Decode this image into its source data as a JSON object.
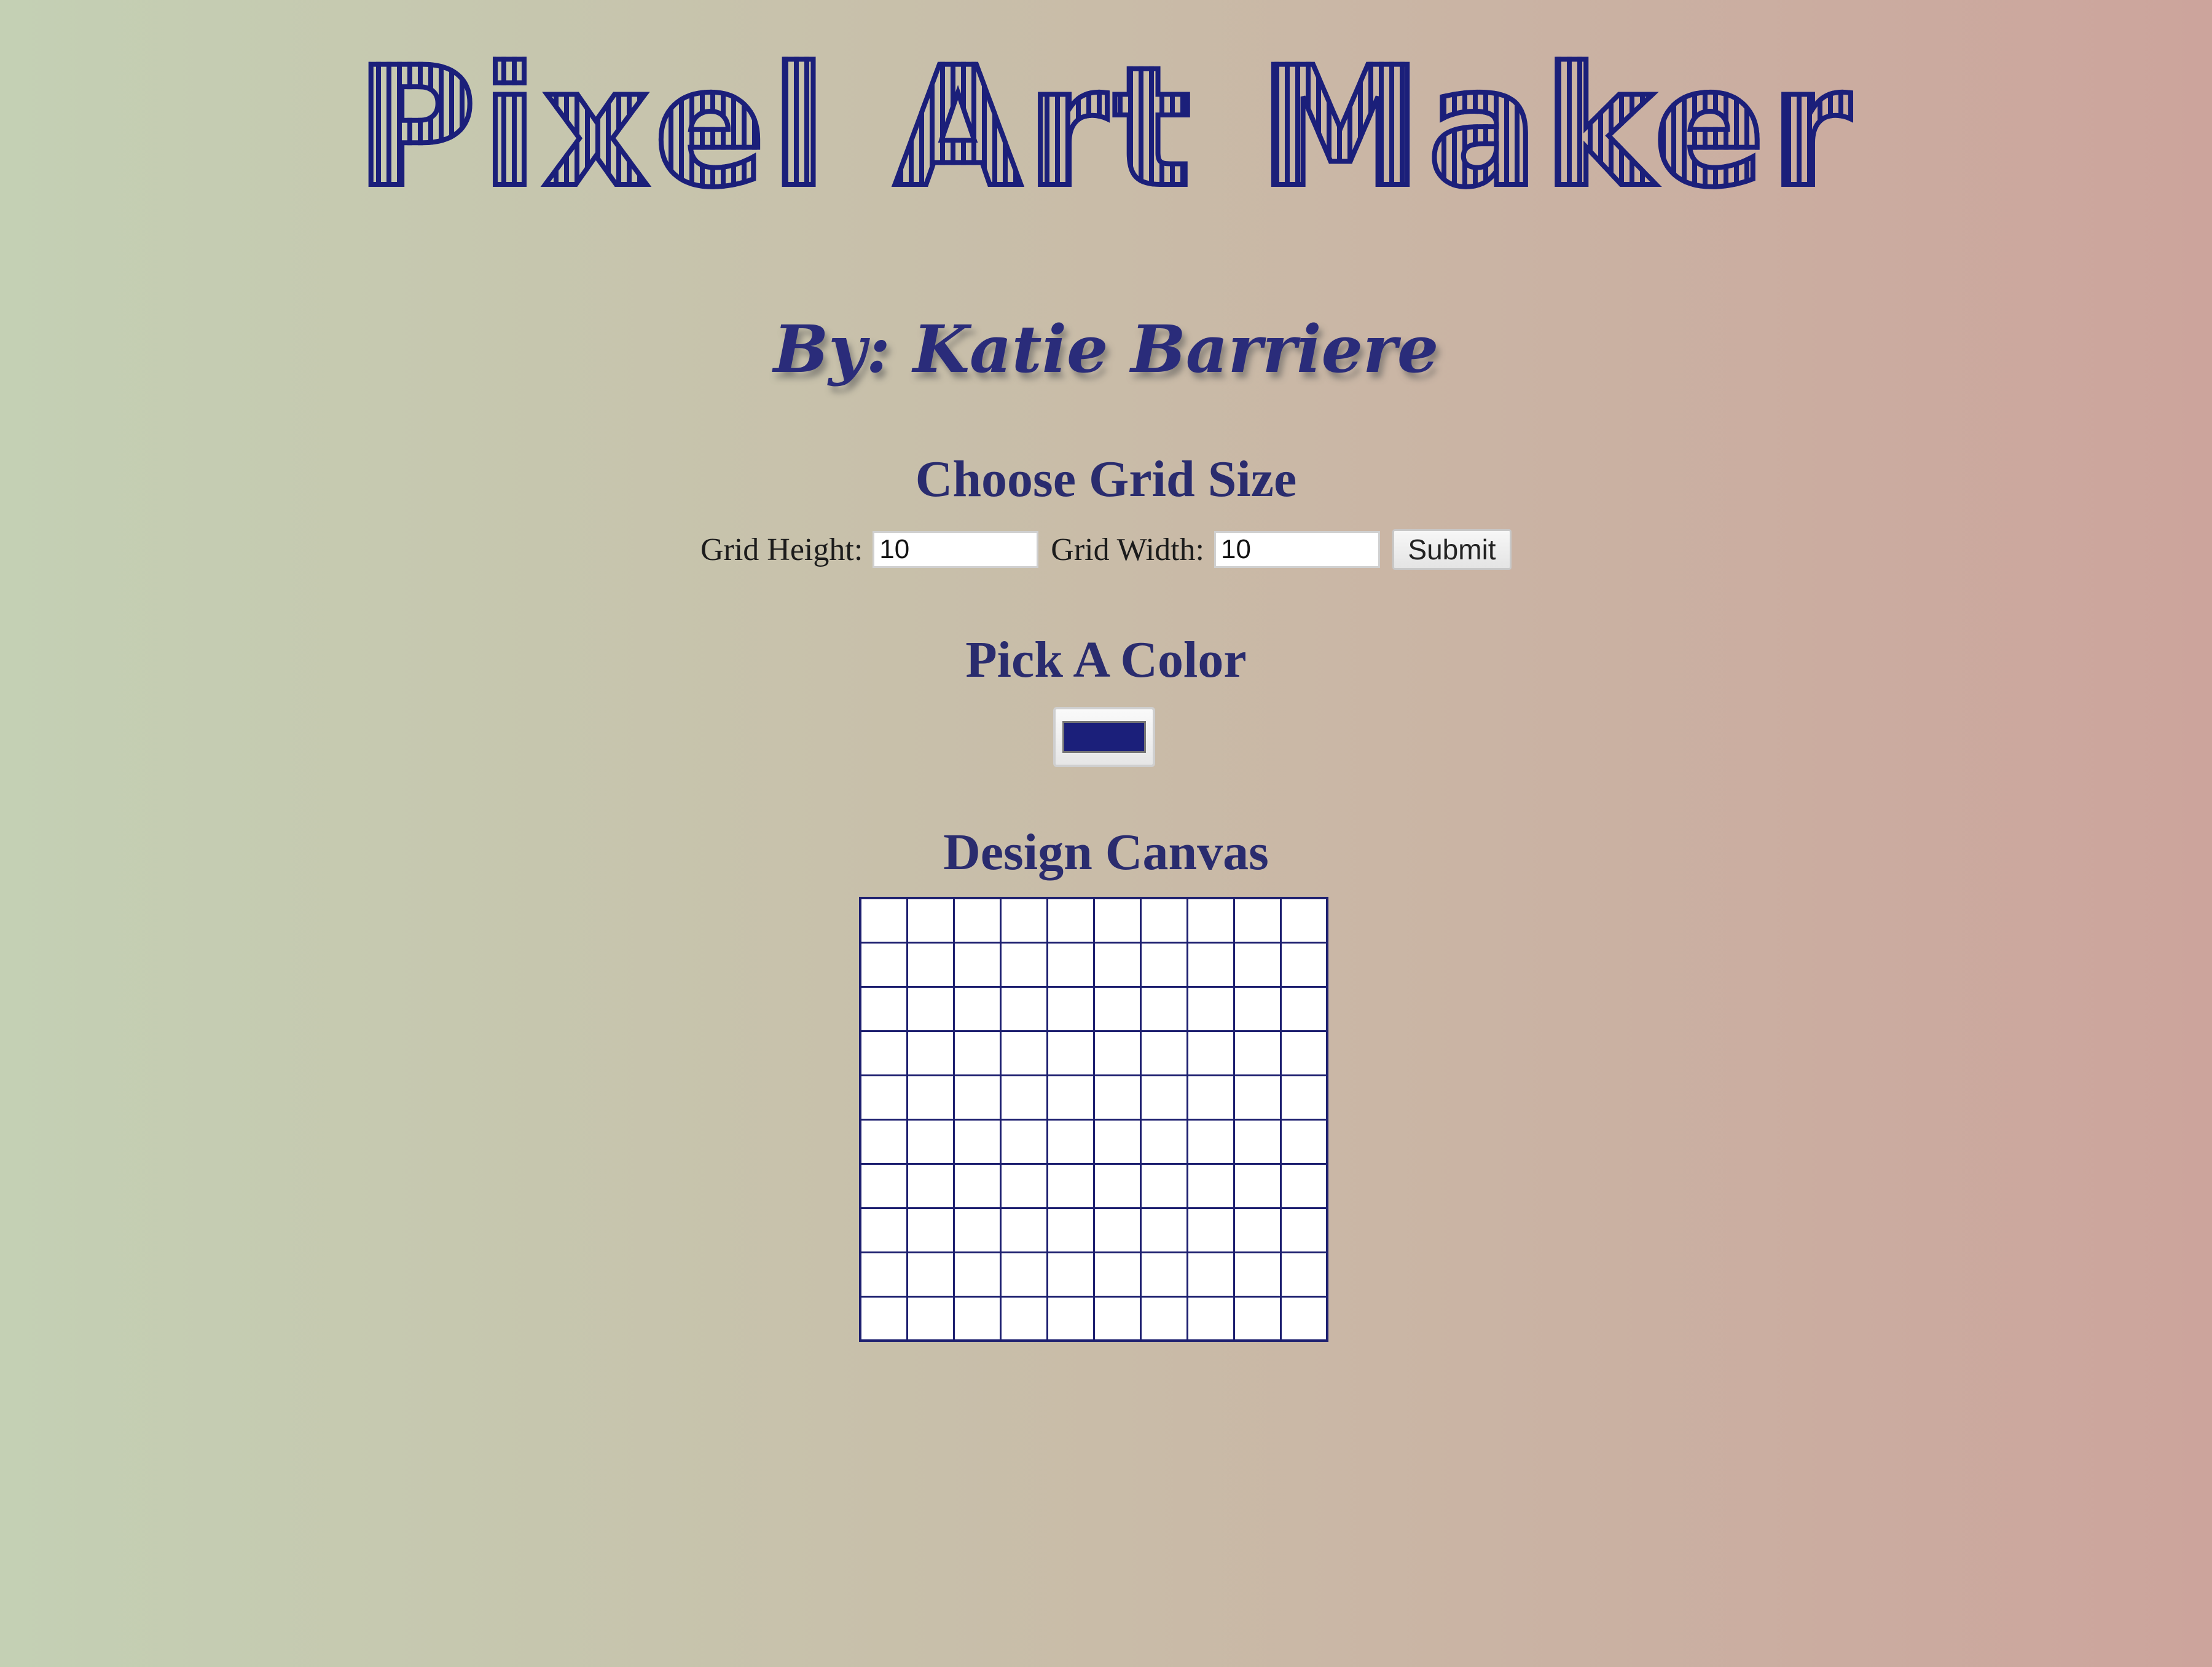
{
  "app": {
    "title": "Pixel Art Maker",
    "author": "By: Katie Barriere"
  },
  "grid_size": {
    "heading": "Choose Grid Size",
    "height_label": "Grid Height:",
    "height_value": "10",
    "width_label": "Grid Width:",
    "width_value": "10",
    "submit_label": "Submit"
  },
  "color": {
    "heading": "Pick A Color",
    "selected": "#1b1f7a"
  },
  "canvas": {
    "heading": "Design Canvas",
    "rows": 10,
    "columns": 10
  },
  "theme": {
    "accent": "#1b1f7a",
    "gradient_left": "#c4d0b4",
    "gradient_right": "#cca49c"
  }
}
